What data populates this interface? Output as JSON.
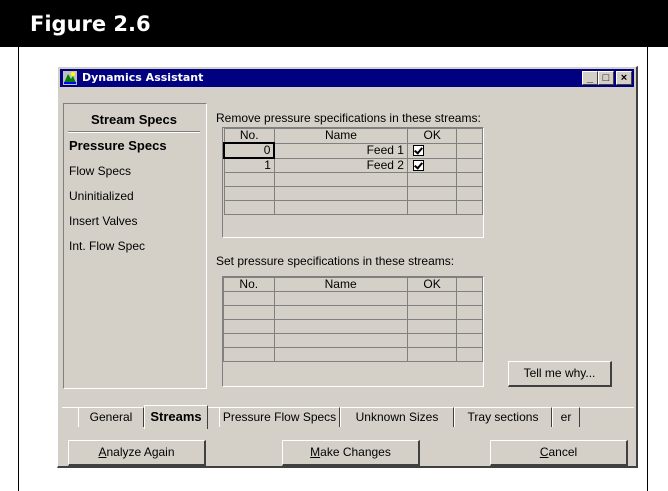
{
  "figure": {
    "title": "Figure 2.6"
  },
  "window": {
    "title": "Dynamics Assistant",
    "controls": {
      "minimize": "_",
      "maximize": "□",
      "close": "×"
    }
  },
  "nav": {
    "heading": "Stream Specs",
    "items": [
      {
        "label": "Pressure Specs",
        "active": true
      },
      {
        "label": "Flow Specs",
        "active": false
      },
      {
        "label": "Uninitialized",
        "active": false
      },
      {
        "label": "Insert Valves",
        "active": false
      },
      {
        "label": "Int. Flow Spec",
        "active": false
      }
    ]
  },
  "remove_section": {
    "label": "Remove pressure specifications in these streams:",
    "columns": {
      "no": "No.",
      "name": "Name",
      "ok": "OK"
    },
    "rows": [
      {
        "no": "0",
        "name": "Feed 1",
        "ok": true
      },
      {
        "no": "1",
        "name": "Feed 2",
        "ok": true
      }
    ]
  },
  "set_section": {
    "label": "Set pressure specifications in these streams:",
    "columns": {
      "no": "No.",
      "name": "Name",
      "ok": "OK"
    },
    "rows": []
  },
  "buttons": {
    "tell_me_why": "Tell me why...",
    "analyze_again": {
      "prefix": "",
      "underlined": "A",
      "rest": "nalyze Again"
    },
    "make_changes": {
      "prefix": "",
      "underlined": "M",
      "rest": "ake Changes"
    },
    "cancel": {
      "prefix": "",
      "underlined": "C",
      "rest": "ancel"
    }
  },
  "main_tabs": [
    {
      "label": "General",
      "active": false
    },
    {
      "label": "Streams",
      "active": true
    },
    {
      "label": "er",
      "active": false
    }
  ],
  "sub_tabs": [
    {
      "label": "Pressure Flow Specs",
      "active": false
    },
    {
      "label": "Unknown Sizes",
      "active": false
    },
    {
      "label": "Tray sections",
      "active": false
    }
  ],
  "colors": {
    "titlebar": "#000080",
    "face": "#d4d0c8",
    "figure_header": "#000000"
  }
}
